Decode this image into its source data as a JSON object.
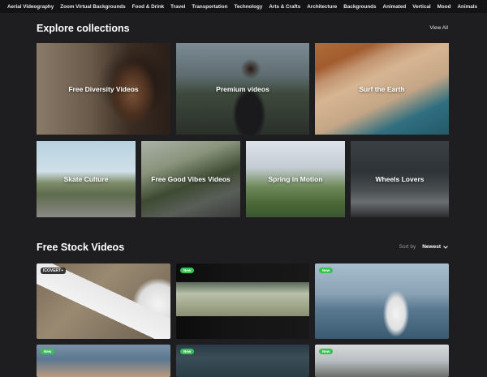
{
  "categories": [
    "Aerial Videography",
    "Zoom Virtual Backgrounds",
    "Food & Drink",
    "Travel",
    "Transportation",
    "Technology",
    "Arts & Crafts",
    "Architecture",
    "Backgrounds",
    "Animated",
    "Vertical",
    "Mood",
    "Animals"
  ],
  "collections": {
    "title": "Explore collections",
    "view_all": "View All",
    "items": [
      {
        "label": "Free Diversity Videos"
      },
      {
        "label": "Premium videos"
      },
      {
        "label": "Surf the Earth"
      },
      {
        "label": "Skate Culture"
      },
      {
        "label": "Free Good Vibes Videos"
      },
      {
        "label": "Spring in Motion"
      },
      {
        "label": "Wheels Lovers"
      }
    ]
  },
  "stock": {
    "title": "Free Stock Videos",
    "sort_label": "Sort by",
    "sort_value": "Newest",
    "videos": [
      {
        "badge": "ICOVERT+"
      },
      {
        "badge": "New"
      },
      {
        "badge": "New"
      },
      {
        "badge": "New"
      },
      {
        "badge": "New"
      },
      {
        "badge": "New"
      }
    ]
  },
  "icons": {
    "sort_chevron": "chevron-down-icon"
  }
}
